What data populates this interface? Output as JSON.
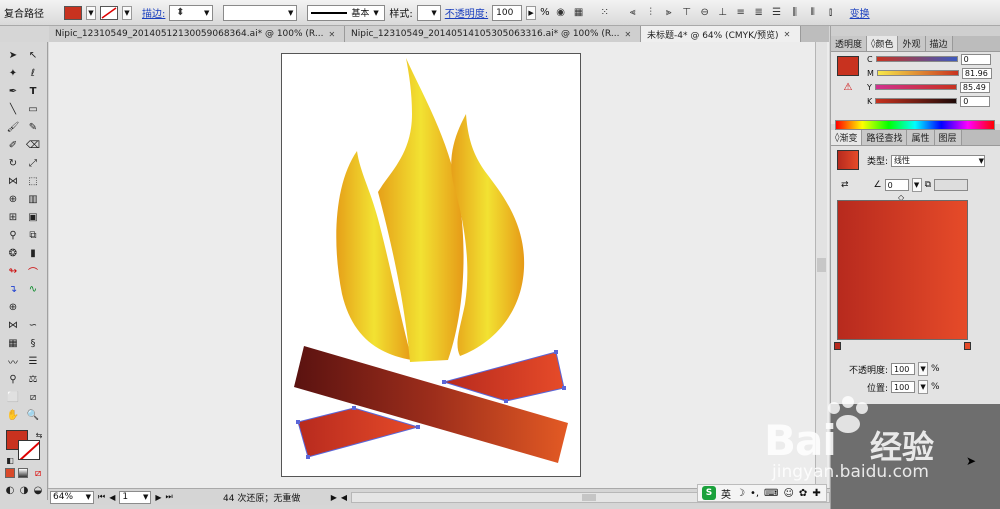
{
  "control_bar": {
    "object_type": "复合路径",
    "stroke_link": "描边:",
    "stroke_profile": "基本",
    "style_label": "样式:",
    "opacity_link": "不透明度:",
    "opacity_value": "100",
    "opacity_unit": "%",
    "transform_link": "变换"
  },
  "tabs": [
    {
      "label": "Nipic_12310549_20140512130059068364.ai* @ 100% (R..."
    },
    {
      "label": "Nipic_12310549_20140514105305063316.ai* @ 100% (R..."
    },
    {
      "label": "未标题-4* @ 64% (CMYK/预览)"
    }
  ],
  "colors": {
    "fill": "#c8321f",
    "flame_light": "#f2e232",
    "flame_dark": "#e6a019",
    "log_dark": "#5a1210",
    "log_mid": "#9c2d1b",
    "log_orange": "#e35a24",
    "log_red": "#d23b2a",
    "selection": "#5a66d9"
  },
  "color_panel": {
    "tabs": [
      "透明度",
      "颜色",
      "外观",
      "描边"
    ],
    "channels": [
      {
        "name": "C",
        "value": "0"
      },
      {
        "name": "M",
        "value": "81.96"
      },
      {
        "name": "Y",
        "value": "85.49"
      },
      {
        "name": "K",
        "value": "0"
      }
    ]
  },
  "gradient_panel": {
    "tabs": [
      "渐变",
      "路径查找",
      "属性",
      "图层"
    ],
    "type_label": "类型:",
    "type_value": "线性",
    "angle_value": "0",
    "opacity_label": "不透明度:",
    "opacity_value": "100",
    "location_label": "位置:",
    "location_value": "100",
    "percent": "%"
  },
  "status_bar": {
    "zoom": "64%",
    "page": "1",
    "message": "44 次还原；无重做"
  },
  "ime": {
    "logo": "S",
    "lang": "英"
  },
  "watermark": {
    "brand": "Bai",
    "brand2": "经验",
    "url": "jingyan.baidu.com"
  }
}
